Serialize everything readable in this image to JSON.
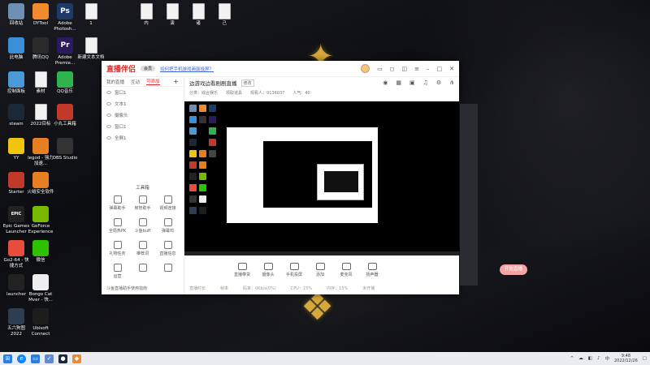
{
  "desktop_icons": [
    {
      "label": "回收站",
      "icon": "recycle-bin-icon",
      "color": "#6d8fb3"
    },
    {
      "label": "DYTool",
      "icon": "dytool-icon",
      "color": "#f08a2a"
    },
    {
      "label": "Adobe Photosh...",
      "icon": "photoshop-icon",
      "color": "#1e3a66",
      "glyph": "Ps"
    },
    {
      "label": "1",
      "icon": "document-icon",
      "color": "#f2f2f2"
    },
    {
      "label": "内",
      "icon": "document-icon",
      "color": "#f2f2f2"
    },
    {
      "label": "演",
      "icon": "document-icon",
      "color": "#f2f2f2"
    },
    {
      "label": "诸",
      "icon": "document-icon",
      "color": "#f2f2f2"
    },
    {
      "label": "己",
      "icon": "document-icon",
      "color": "#f2f2f2"
    },
    {
      "label": "此电脑",
      "icon": "computer-icon",
      "color": "#3b8fd8"
    },
    {
      "label": "腾讯QQ",
      "icon": "qq-icon",
      "color": "#2b2b2b"
    },
    {
      "label": "Adobe Premie...",
      "icon": "premiere-icon",
      "color": "#2a1a5e",
      "glyph": "Pr"
    },
    {
      "label": "新建文本文档",
      "icon": "document-icon",
      "color": "#f2f2f2"
    },
    {
      "label": "控制面板",
      "icon": "control-panel-icon",
      "color": "#4a9ad8"
    },
    {
      "label": "素材",
      "icon": "document-icon",
      "color": "#f2f2f2"
    },
    {
      "label": "QQ音乐",
      "icon": "qq-music-icon",
      "color": "#2fb34f"
    },
    {
      "label": "steam",
      "icon": "steam-icon",
      "color": "#1b2838"
    },
    {
      "label": "2022目标",
      "icon": "document-icon",
      "color": "#f2f2f2"
    },
    {
      "label": "小丸工具箱",
      "icon": "toolbox-icon",
      "color": "#c0392b"
    },
    {
      "label": "YY",
      "icon": "yy-icon",
      "color": "#f1c40f"
    },
    {
      "label": "legod - 强力加速...",
      "icon": "legod-icon",
      "color": "#e67e22"
    },
    {
      "label": "OBS Studio",
      "icon": "obs-icon",
      "color": "#333"
    },
    {
      "label": "Starter",
      "icon": "starter-icon",
      "color": "#c0392b"
    },
    {
      "label": "火绒安全软件",
      "icon": "huorong-icon",
      "color": "#e67e22"
    },
    {
      "label": "Epic Games Launcher",
      "icon": "epic-icon",
      "color": "#222",
      "glyph": "EPIC"
    },
    {
      "label": "GeForce Experience",
      "icon": "geforce-icon",
      "color": "#76b900"
    },
    {
      "label": "Go2-64 - 快捷方式",
      "icon": "go2-icon",
      "color": "#e74c3c"
    },
    {
      "label": "微信",
      "icon": "wechat-icon",
      "color": "#2dc100"
    },
    {
      "label": "launcher",
      "icon": "launcher-icon",
      "color": "#222"
    },
    {
      "label": "Bongo Cat Mver - 快...",
      "icon": "bongo-cat-icon",
      "color": "#eee"
    },
    {
      "label": "五六狗图 2022",
      "icon": "five-six-icon",
      "color": "#2c3e50"
    },
    {
      "label": "Ubisoft Connect",
      "icon": "ubisoft-icon",
      "color": "#1d1d1d"
    }
  ],
  "window": {
    "logo": "直播伴侣",
    "badge": "会员",
    "link": "如何把手机游戏画面投屏？",
    "tabs": [
      "我的直播",
      "互动",
      "可添加"
    ],
    "scenes": [
      "窗口1",
      "文本1",
      "摄像头",
      "窗口1",
      "全屏1"
    ],
    "toolbox_title": "工具箱",
    "tools": [
      "弹幕助手",
      "房管助手",
      "视频连接",
      "全局热PK",
      "斗鱼buff",
      "弹幕鸡",
      "礼物任务",
      "推荐词",
      "直播信息",
      "运营",
      "",
      ""
    ],
    "footer_note": "斗鱼直播助手使用指南",
    "room_title": "边游戏边看剧剧直播",
    "room_tag": "修改",
    "sub_info": [
      "分类：综合娱乐",
      "领取道具",
      "观看人：9136037",
      "人气：40"
    ],
    "controls": [
      "直播带货",
      "摄像头",
      "手机投屏",
      "添加",
      "麦克风",
      "扬声器"
    ],
    "golive": "开始直播",
    "status": [
      "直播时长",
      "帧率",
      "码率：0Kb/s(0%)",
      "CPU：15%",
      "内存：15%",
      "未开播"
    ]
  },
  "taskbar": {
    "time": "9:48",
    "date": "2022/12/26",
    "language": "中"
  }
}
